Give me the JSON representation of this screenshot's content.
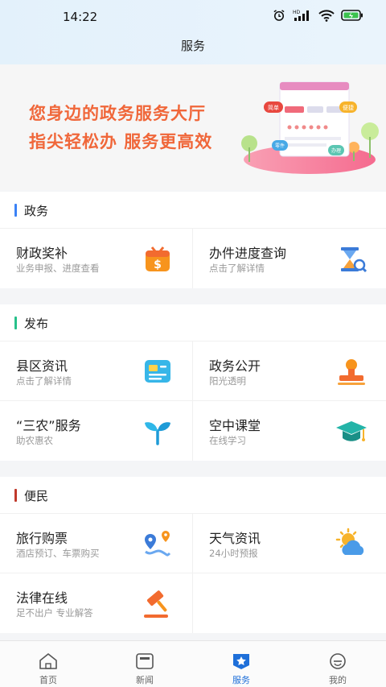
{
  "status": {
    "time": "14:22",
    "network_label": "HD"
  },
  "header": {
    "title": "服务"
  },
  "banner": {
    "line1": "您身边的政务服务大厅",
    "line2": "指尖轻松办  服务更高效",
    "tags": [
      "简单",
      "便捷",
      "零件",
      "办理"
    ]
  },
  "sections": {
    "zhengwu": {
      "title": "政务",
      "color": "#3b82f6",
      "items": [
        {
          "name": "财政奖补",
          "sub": "业务申报、进度查看"
        },
        {
          "name": "办件进度查询",
          "sub": "点击了解详情"
        }
      ]
    },
    "fabu": {
      "title": "发布",
      "color": "#27c08a",
      "items": [
        {
          "name": "县区资讯",
          "sub": "点击了解详情"
        },
        {
          "name": "政务公开",
          "sub": "阳光透明"
        },
        {
          "name": "“三农”服务",
          "sub": "助农惠农"
        },
        {
          "name": "空中课堂",
          "sub": "在线学习"
        }
      ]
    },
    "bianmin": {
      "title": "便民",
      "color": "#c0392b",
      "items": [
        {
          "name": "旅行购票",
          "sub": "酒店预订、车票购买"
        },
        {
          "name": "天气资讯",
          "sub": "24小时预报"
        },
        {
          "name": "法律在线",
          "sub": "足不出户  专业解答"
        }
      ]
    }
  },
  "tabs": [
    {
      "label": "首页",
      "active": false
    },
    {
      "label": "新闻",
      "active": false
    },
    {
      "label": "服务",
      "active": true
    },
    {
      "label": "我的",
      "active": false
    }
  ],
  "colors": {
    "accent": "#1e6fd9",
    "banner_text": "#f0673a"
  }
}
